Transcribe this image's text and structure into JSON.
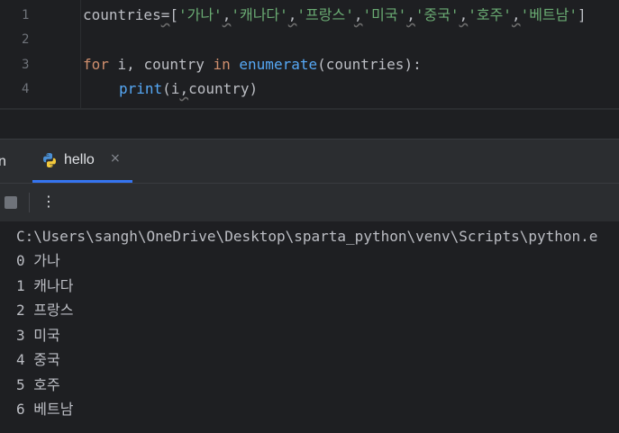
{
  "editor": {
    "line_numbers": [
      "1",
      "2",
      "3",
      "4"
    ],
    "line1": {
      "var": "countries",
      "op": "=",
      "lb": "[",
      "items": [
        "'가나'",
        "'캐나다'",
        "'프랑스'",
        "'미국'",
        "'중국'",
        "'호주'",
        "'베트남'"
      ],
      "comma": ",",
      "rb": "]"
    },
    "line3": {
      "kw_for": "for",
      "vars": " i, country ",
      "kw_in": "in",
      "sp": " ",
      "fn": "enumerate",
      "args": "(countries):"
    },
    "line4": {
      "fn": "print",
      "lp": "(i",
      "comma": ",",
      "rest": "country)"
    }
  },
  "toolwindow": {
    "run_label": "n",
    "tab_label": "hello",
    "close_glyph": "×",
    "more_glyph": "⋮"
  },
  "console": {
    "lines": [
      "C:\\Users\\sangh\\OneDrive\\Desktop\\sparta_python\\venv\\Scripts\\python.e",
      "0 가나",
      "1 캐나다",
      "2 프랑스",
      "3 미국",
      "4 중국",
      "5 호주",
      "6 베트남"
    ]
  },
  "colors": {
    "background": "#1e1f22",
    "panel": "#2b2d30",
    "keyword": "#cf8e6d",
    "string": "#6aab73",
    "function": "#56a8f5",
    "accent": "#3574f0"
  }
}
